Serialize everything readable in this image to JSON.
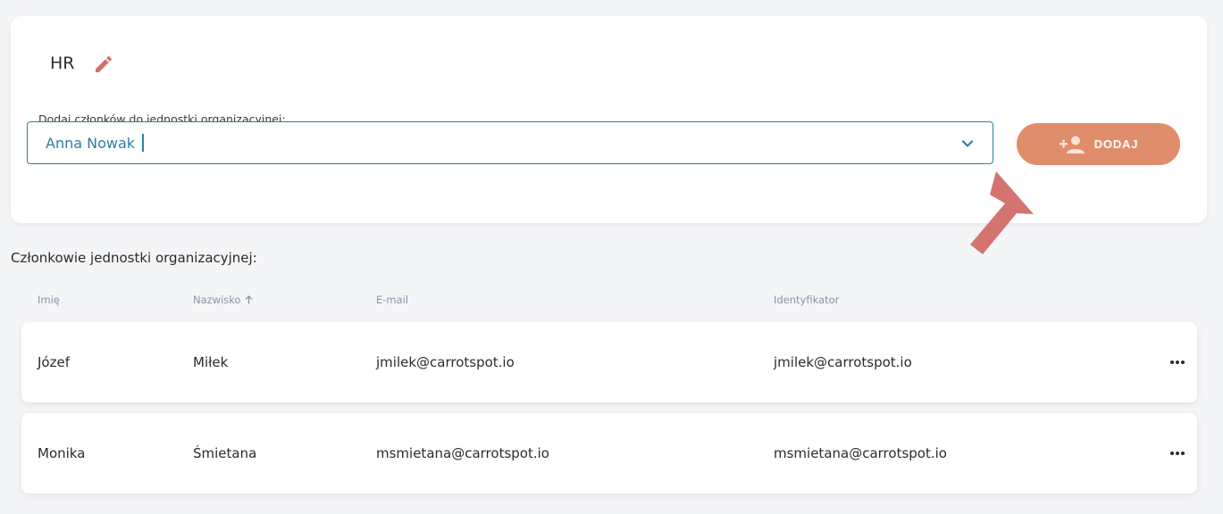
{
  "unit": {
    "name": "HR"
  },
  "add_members": {
    "label": "Dodaj członków do jednostki organizacyjnej:",
    "selected_value": "Anna Nowak",
    "button_label": "DODAJ"
  },
  "members": {
    "heading": "Członkowie jednostki organizacyjnej:",
    "columns": {
      "first_name": "Imię",
      "last_name": "Nazwisko",
      "email": "E-mail",
      "identifier": "Identyfikator"
    },
    "sort": {
      "column": "last_name",
      "direction": "ascending",
      "icon": "arrow-up-icon"
    },
    "rows": [
      {
        "first_name": "Józef",
        "last_name": "Miłek",
        "email": "jmilek@carrotspot.io",
        "identifier": "jmilek@carrotspot.io"
      },
      {
        "first_name": "Monika",
        "last_name": "Śmietana",
        "email": "msmietana@carrotspot.io",
        "identifier": "msmietana@carrotspot.io"
      }
    ]
  },
  "colors": {
    "accent": "#e08d6c",
    "input_focus": "#2c7fa0",
    "edit_icon": "#d4716b",
    "annotation_arrow": "#d47470",
    "muted_text": "#8a93a6",
    "background": "#f4f5f7"
  },
  "icons": [
    "pencil-icon",
    "chevron-down-icon",
    "add-person-icon",
    "arrow-up-icon",
    "more-horizontal-icon",
    "annotation-arrow"
  ]
}
